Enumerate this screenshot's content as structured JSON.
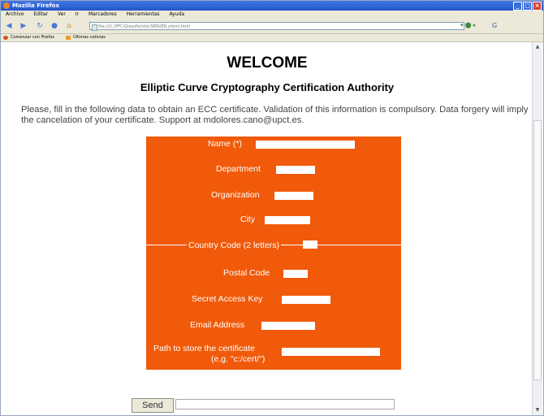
{
  "browser": {
    "title": "Mozilla Firefox",
    "menu": [
      "Archivo",
      "Editar",
      "Ver",
      "Ir",
      "Marcadores",
      "Herramientas",
      "Ayuda"
    ],
    "url": "file:///C:/PFC/Glassfish/dir/SERVER.xhtml.html",
    "bookmarks": [
      "Comenzar con Firefox",
      "Últimas noticias"
    ]
  },
  "page": {
    "heading": "WELCOME",
    "subheading": "Elliptic Curve Cryptography Certification Authority",
    "intro": "Please, fill in the following data to obtain an ECC certificate. Validation of this information is compulsory. Data forgery will imply the cancelation of your certificate. Support at mdolores.cano@upct.es."
  },
  "form": {
    "name_label": "Name (*)",
    "department_label": "Department",
    "organization_label": "Organization",
    "city_label": "City",
    "country_label": "Country Code (2 letters)",
    "postal_label": "Postal Code",
    "secret_label": "Secret Access Key",
    "email_label": "Email Address",
    "path_label_1": "Path to store the certificate",
    "path_label_2": "(e.g. \"c:/cert/\")",
    "send_label": "Send",
    "background_color": "#f05a0a"
  }
}
